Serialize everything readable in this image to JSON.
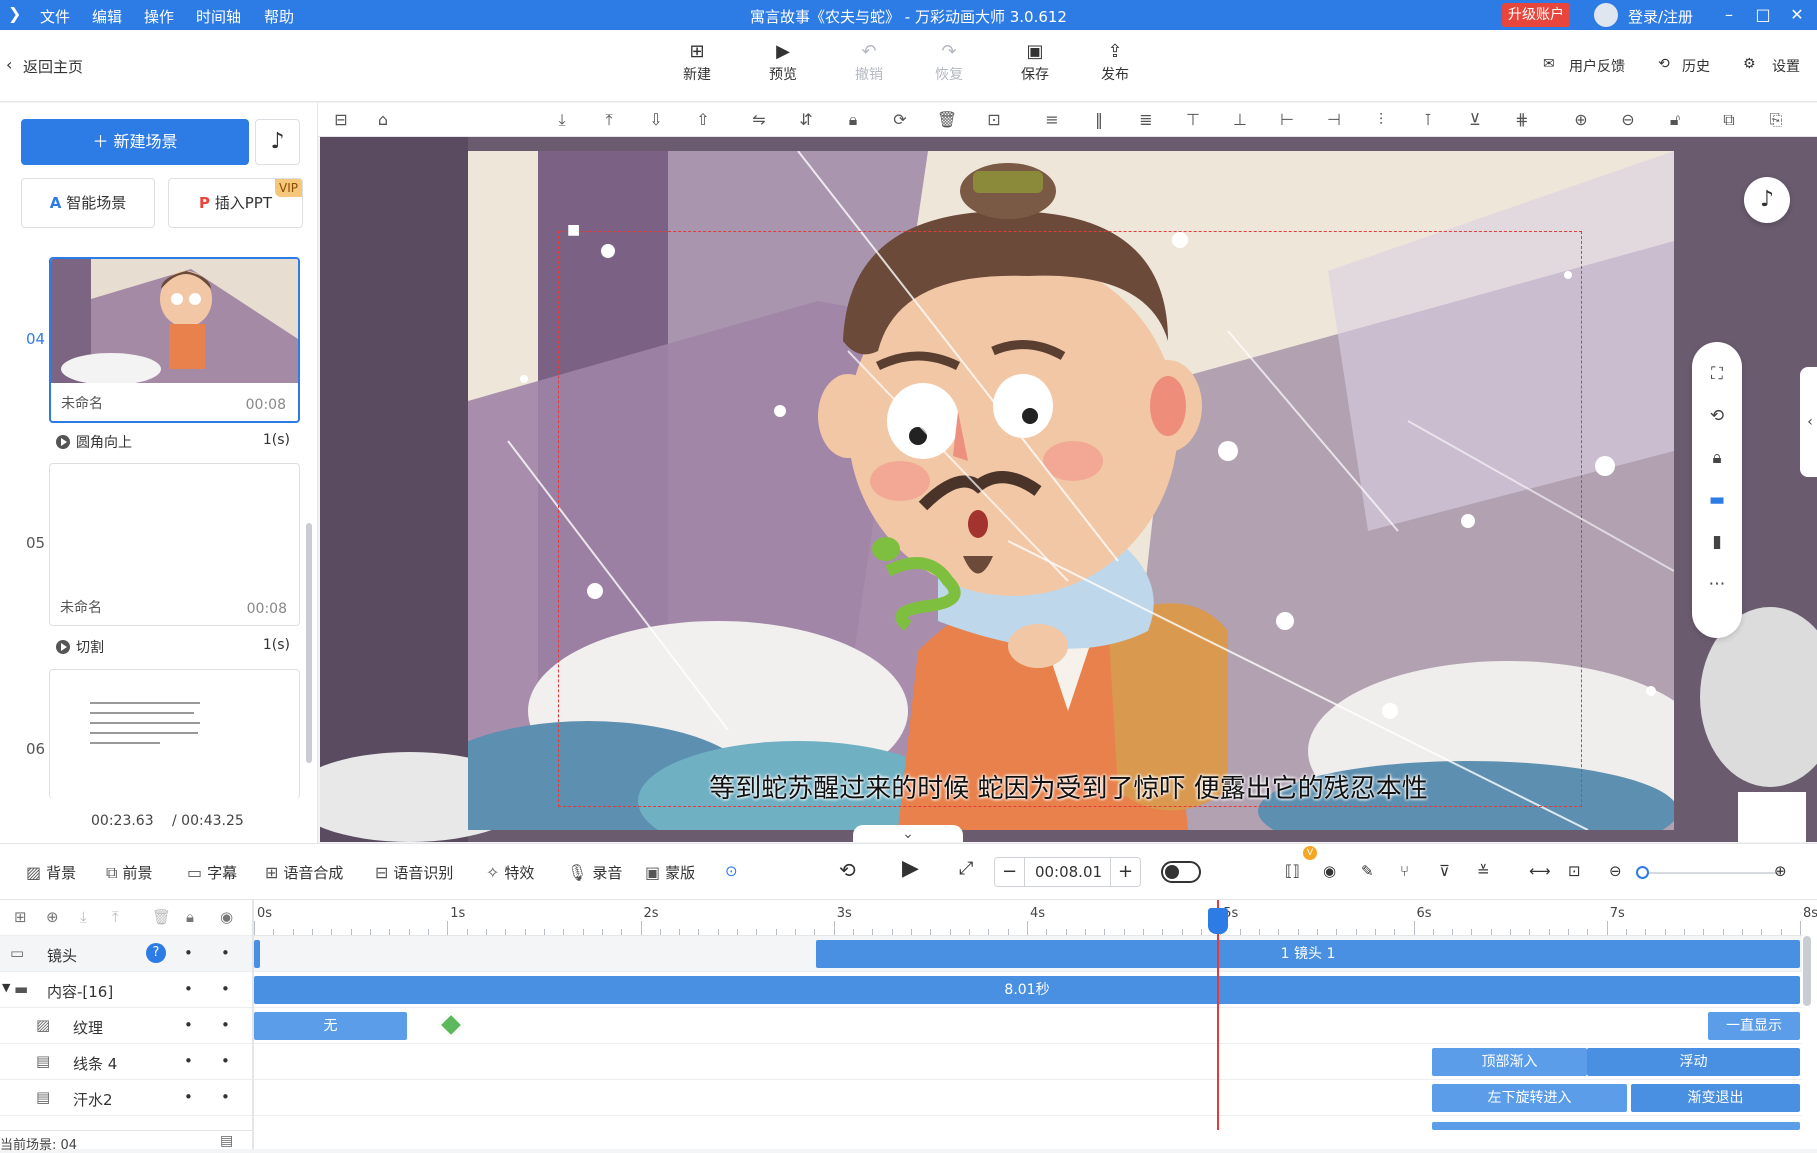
{
  "titlebar": {
    "menus": [
      "文件",
      "编辑",
      "操作",
      "时间轴",
      "帮助"
    ],
    "title": "寓言故事《农夫与蛇》 - 万彩动画大师 3.0.612",
    "upgrade": "升级账户",
    "login": "登录/注册"
  },
  "header": {
    "back": "返回主页",
    "tools": {
      "new": "新建",
      "preview": "预览",
      "undo": "撤销",
      "redo": "恢复",
      "save": "保存",
      "publish": "发布"
    },
    "feedback": "用户反馈",
    "history": "历史",
    "settings": "设置"
  },
  "left": {
    "new_scene": "新建场景",
    "smart_scene": "智能场景",
    "insert_ppt": "插入PPT",
    "vip": "VIP",
    "scenes": [
      {
        "num": "04",
        "name": "未命名",
        "dur": "00:08"
      },
      {
        "num": "05",
        "name": "未命名",
        "dur": "00:08"
      },
      {
        "num": "06"
      }
    ],
    "transitions": [
      {
        "name": "圆角向上",
        "dur": "1(s)"
      },
      {
        "name": "切割",
        "dur": "1(s)"
      }
    ],
    "time_current": "00:23.63",
    "time_total": "/ 00:43.25"
  },
  "stage": {
    "subtitle": "等到蛇苏醒过来的时候 蛇因为受到了惊吓 便露出它的残忍本性"
  },
  "bottom": {
    "items": [
      "背景",
      "前景",
      "字幕",
      "语音合成",
      "语音识别",
      "特效",
      "录音",
      "蒙版"
    ],
    "time": "00:08.01"
  },
  "timeline": {
    "ruler": [
      "0s",
      "1s",
      "2s",
      "3s",
      "4s",
      "5s",
      "6s",
      "7s",
      "8s"
    ],
    "tracks": [
      {
        "name": "镜头"
      },
      {
        "name": "内容-[16]"
      },
      {
        "name": "纹理"
      },
      {
        "name": "线条 4"
      },
      {
        "name": "汗水2"
      }
    ],
    "bars": {
      "camera": "1 镜头 1",
      "content": "8.01秒",
      "texture_none": "无",
      "texture_show": "一直显示",
      "line_in": "顶部渐入",
      "line_float": "浮动",
      "sweat_in": "左下旋转进入",
      "sweat_out": "渐变退出"
    },
    "status": "当前场景: 04"
  },
  "colors": {
    "accent": "#2d7be5",
    "playhead": "#e5393b",
    "upgrade": "#e8453c"
  }
}
